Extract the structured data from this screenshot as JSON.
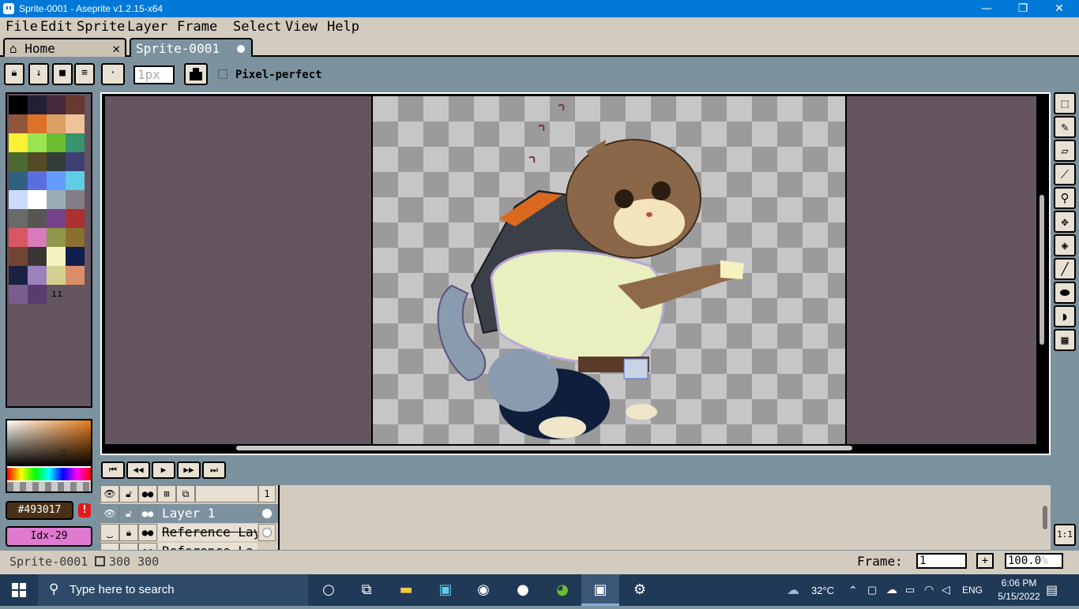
{
  "window": {
    "title": "Sprite-0001 - Aseprite v1.2.15-x64",
    "minimize": "—",
    "restore": "❐",
    "close": "✕"
  },
  "menu": [
    "File",
    "Edit",
    "Sprite",
    "Layer",
    "Frame",
    "Select",
    "View",
    "Help"
  ],
  "tabs": {
    "home": "Home",
    "home_close": "✕",
    "sprite": "Sprite-0001"
  },
  "context_bar": {
    "brush_size_placeholder": "1px",
    "pixel_perfect": "Pixel-perfect"
  },
  "palette": {
    "colors": [
      "#000000",
      "#222034",
      "#45283c",
      "#663931",
      "#8f563b",
      "#df7126",
      "#d9a066",
      "#eec39a",
      "#fbf236",
      "#99e550",
      "#6abe30",
      "#37946e",
      "#4b692f",
      "#524b24",
      "#323c39",
      "#3f3f74",
      "#306082",
      "#5b6ee1",
      "#639bff",
      "#5fcde4",
      "#cbdbfc",
      "#ffffff",
      "#9badb7",
      "#847e87",
      "#696a6a",
      "#595652",
      "#76428a",
      "#ac3232",
      "#d95763",
      "#d77bba",
      "#8f974a",
      "#8a6f30",
      "#754533",
      "#3a3634",
      "#f6f2c0",
      "#0f1e4a",
      "#1b2240",
      "#9a83bd",
      "#d4d08f",
      "#db8c69",
      "#7a5d8e",
      "#5a3b6d"
    ],
    "foreground_hex": "#493017",
    "foreground_label": "#493017",
    "background_label": "Idx-29",
    "warning": "!",
    "options": "ıı"
  },
  "tools": [
    {
      "name": "rectangular-marquee-tool",
      "glyph": "⬚"
    },
    {
      "name": "pencil-tool",
      "glyph": "✎"
    },
    {
      "name": "eraser-tool",
      "glyph": "▱"
    },
    {
      "name": "eyedropper-tool",
      "glyph": "⟋"
    },
    {
      "name": "zoom-tool",
      "glyph": "⚲"
    },
    {
      "name": "move-tool",
      "glyph": "✥"
    },
    {
      "name": "paint-bucket-tool",
      "glyph": "◈"
    },
    {
      "name": "line-tool",
      "glyph": "╱"
    },
    {
      "name": "ellipse-tool",
      "glyph": "⬬"
    },
    {
      "name": "contour-tool",
      "glyph": "◗"
    },
    {
      "name": "spray-tool",
      "glyph": "▦"
    }
  ],
  "animation": [
    "⏮",
    "◀◀",
    "▶",
    "▶▶",
    "⏭"
  ],
  "timeline": {
    "frame_number": "1",
    "layers": [
      {
        "name": "Layer 1",
        "strike": false
      },
      {
        "name": "Reference Lay",
        "strike": true
      },
      {
        "name": "Reference La",
        "strike": true
      }
    ],
    "zoom_one": "1:1"
  },
  "status": {
    "sprite_name": "Sprite-0001",
    "size": "300  300",
    "frame_label": "Frame:",
    "frame_value": "1",
    "frame_add": "+",
    "zoom_value": "100.0",
    "zoom_unit": "%"
  },
  "taskbar": {
    "search_placeholder": "Type here to search",
    "weather": "32°C",
    "language": "ENG",
    "time": "6:06 PM",
    "date": "5/15/2022"
  }
}
